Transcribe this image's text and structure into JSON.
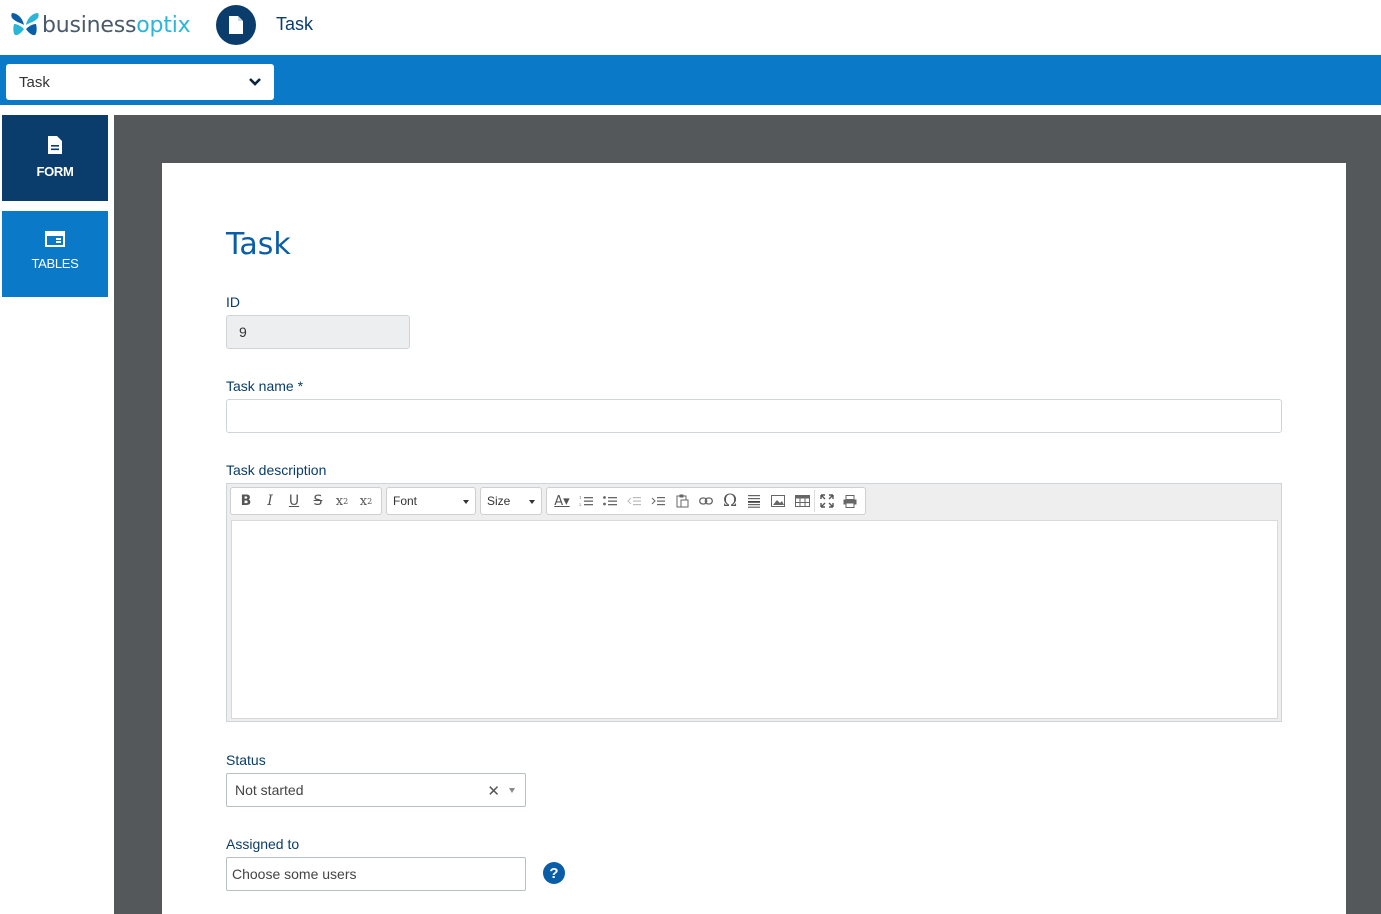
{
  "header": {
    "brand_part1": "business",
    "brand_part2": "optix",
    "page_title": "Task",
    "doc_icon": "document-icon"
  },
  "view_selector": {
    "value": "Task",
    "icon": "chevron-down-icon"
  },
  "sidebar": {
    "items": [
      {
        "label": "FORM",
        "icon": "document-icon",
        "active": true
      },
      {
        "label": "TABLES",
        "icon": "table-icon",
        "active": false
      }
    ]
  },
  "form": {
    "title": "Task",
    "id_label": "ID",
    "id_value": "9",
    "task_name_label": "Task name *",
    "task_name_value": "",
    "task_description_label": "Task description",
    "editor": {
      "font_label": "Font",
      "size_label": "Size"
    },
    "status_label": "Status",
    "status_value": "Not started",
    "assigned_label": "Assigned to",
    "assigned_placeholder": "Choose some users",
    "help_icon_text": "?"
  },
  "colors": {
    "primary_blue": "#0a79c8",
    "dark_navy": "#0a3d6b",
    "workspace_gray": "#54585b",
    "title_blue": "#0a5ea8",
    "brand_cyan": "#29b6d8"
  }
}
